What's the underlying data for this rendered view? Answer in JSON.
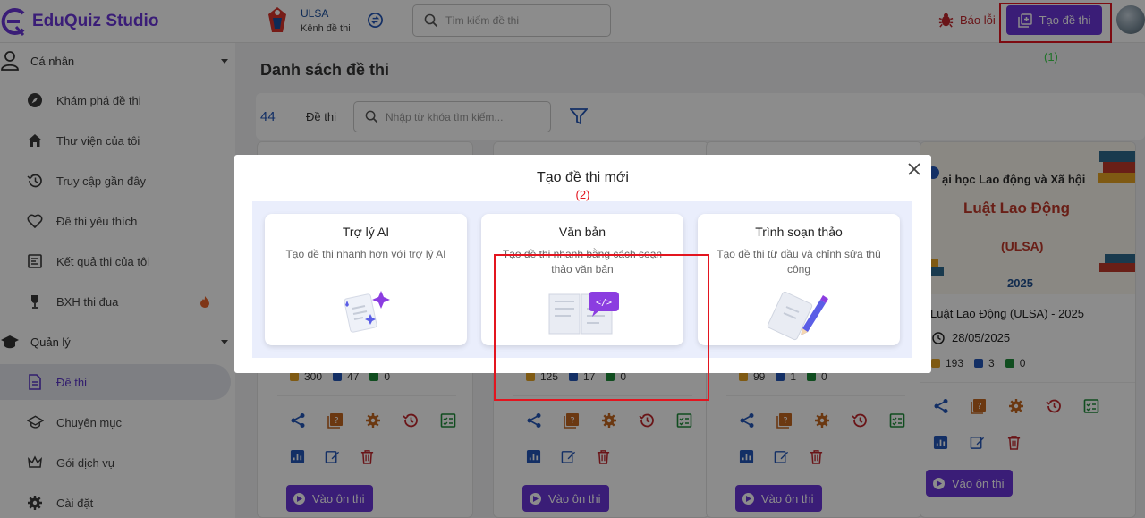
{
  "app": {
    "name": "EduQuiz Studio",
    "accent": "#6a35d9"
  },
  "header": {
    "channel_name": "ULSA",
    "channel_sub": "Kênh đề thi",
    "search_placeholder": "Tìm kiếm đề thi",
    "report_label": "Báo lỗi",
    "create_label": "Tạo đề thi",
    "annotation_1": "(1)"
  },
  "sidebar": {
    "section_personal": "Cá nhân",
    "personal_items": [
      {
        "label": "Khám phá đề thi",
        "icon": "compass-icon"
      },
      {
        "label": "Thư viện của tôi",
        "icon": "home-icon"
      },
      {
        "label": "Truy cập gần đây",
        "icon": "history-icon"
      },
      {
        "label": "Đề thi yêu thích",
        "icon": "heart-icon"
      },
      {
        "label": "Kết quả thi của tôi",
        "icon": "results-icon"
      },
      {
        "label": "BXH thi đua",
        "icon": "trophy-icon"
      }
    ],
    "section_manage": "Quản lý",
    "manage_items": [
      {
        "label": "Đề thi",
        "icon": "document-icon",
        "active": true
      },
      {
        "label": "Chuyên mục",
        "icon": "graduation-cap-icon"
      },
      {
        "label": "Gói dịch vụ",
        "icon": "crown-icon"
      },
      {
        "label": "Cài đặt",
        "icon": "gear-icon"
      }
    ]
  },
  "main": {
    "page_title": "Danh sách đề thi",
    "count": "44",
    "count_label": "Đề thi",
    "filter_placeholder": "Nhập từ khóa tìm kiếm...",
    "cards": [
      {
        "questions": "300",
        "attempts": "47",
        "saves": "0",
        "button": "Vào ôn thi"
      },
      {
        "questions": "125",
        "attempts": "17",
        "saves": "0",
        "button": "Vào ôn thi"
      },
      {
        "questions": "99",
        "attempts": "1",
        "saves": "0",
        "button": "Vào ôn thi"
      },
      {
        "banner_line1": "ại học Lao động và Xã hội",
        "banner_line2": "Luật Lao Động",
        "banner_line3": "(ULSA)",
        "banner_line4": "2025",
        "title": "Luật Lao Động (ULSA) - 2025",
        "date": "28/05/2025",
        "questions": "193",
        "attempts": "3",
        "saves": "0",
        "button": "Vào ôn thi"
      }
    ]
  },
  "modal": {
    "title": "Tạo đề thi mới",
    "annotation_2": "(2)",
    "options": [
      {
        "title": "Trợ lý AI",
        "desc": "Tạo đề thi nhanh hơn với trợ lý AI",
        "icon": "ai-document-icon"
      },
      {
        "title": "Văn bản",
        "desc": "Tạo đề thi nhanh bằng cách soạn thảo văn bản",
        "icon": "code-book-icon"
      },
      {
        "title": "Trình soạn thảo",
        "desc": "Tạo đề thi từ đầu và chỉnh sửa thủ công",
        "icon": "pencil-document-icon"
      }
    ]
  }
}
